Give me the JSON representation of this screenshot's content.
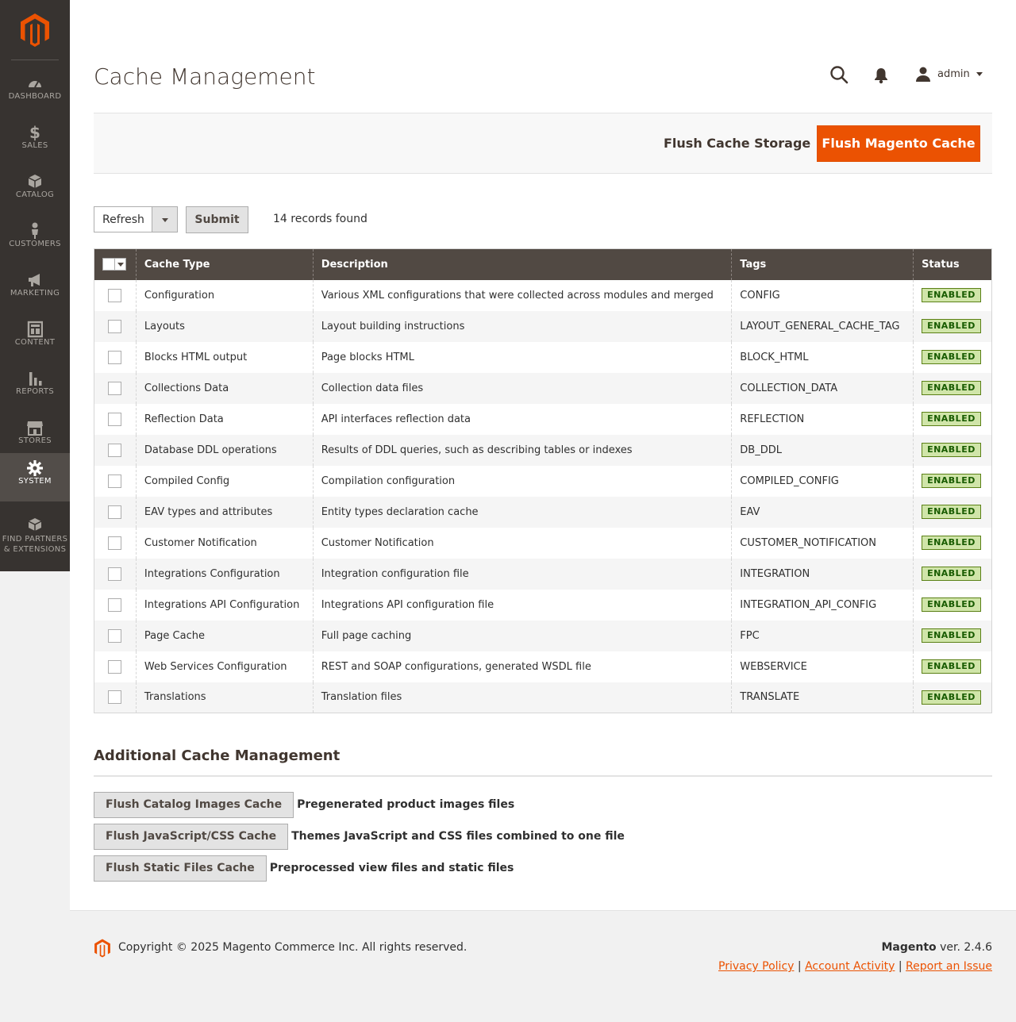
{
  "sidebar": {
    "items": [
      {
        "label": "DASHBOARD",
        "icon": "dashboard-icon"
      },
      {
        "label": "SALES",
        "icon": "dollar-icon"
      },
      {
        "label": "CATALOG",
        "icon": "cube-icon"
      },
      {
        "label": "CUSTOMERS",
        "icon": "person-icon"
      },
      {
        "label": "MARKETING",
        "icon": "megaphone-icon"
      },
      {
        "label": "CONTENT",
        "icon": "layout-icon"
      },
      {
        "label": "REPORTS",
        "icon": "bar-chart-icon"
      },
      {
        "label": "STORES",
        "icon": "storefront-icon"
      },
      {
        "label": "SYSTEM",
        "icon": "gear-icon",
        "active": true
      },
      {
        "label": "FIND PARTNERS",
        "label2": "& EXTENSIONS",
        "icon": "boxes-icon"
      }
    ]
  },
  "header": {
    "title": "Cache Management",
    "user": "admin"
  },
  "actions": {
    "flush_storage": "Flush Cache Storage",
    "flush_magento": "Flush Magento Cache"
  },
  "toolbar": {
    "mass_action": "Refresh",
    "submit": "Submit",
    "records": "14 records found"
  },
  "grid": {
    "columns": [
      "Cache Type",
      "Description",
      "Tags",
      "Status"
    ],
    "rows": [
      {
        "type": "Configuration",
        "desc": "Various XML configurations that were collected across modules and merged",
        "tags": "CONFIG",
        "status": "ENABLED"
      },
      {
        "type": "Layouts",
        "desc": "Layout building instructions",
        "tags": "LAYOUT_GENERAL_CACHE_TAG",
        "status": "ENABLED"
      },
      {
        "type": "Blocks HTML output",
        "desc": "Page blocks HTML",
        "tags": "BLOCK_HTML",
        "status": "ENABLED"
      },
      {
        "type": "Collections Data",
        "desc": "Collection data files",
        "tags": "COLLECTION_DATA",
        "status": "ENABLED"
      },
      {
        "type": "Reflection Data",
        "desc": "API interfaces reflection data",
        "tags": "REFLECTION",
        "status": "ENABLED"
      },
      {
        "type": "Database DDL operations",
        "desc": "Results of DDL queries, such as describing tables or indexes",
        "tags": "DB_DDL",
        "status": "ENABLED"
      },
      {
        "type": "Compiled Config",
        "desc": "Compilation configuration",
        "tags": "COMPILED_CONFIG",
        "status": "ENABLED"
      },
      {
        "type": "EAV types and attributes",
        "desc": "Entity types declaration cache",
        "tags": "EAV",
        "status": "ENABLED"
      },
      {
        "type": "Customer Notification",
        "desc": "Customer Notification",
        "tags": "CUSTOMER_NOTIFICATION",
        "status": "ENABLED"
      },
      {
        "type": "Integrations Configuration",
        "desc": "Integration configuration file",
        "tags": "INTEGRATION",
        "status": "ENABLED"
      },
      {
        "type": "Integrations API Configuration",
        "desc": "Integrations API configuration file",
        "tags": "INTEGRATION_API_CONFIG",
        "status": "ENABLED"
      },
      {
        "type": "Page Cache",
        "desc": "Full page caching",
        "tags": "FPC",
        "status": "ENABLED"
      },
      {
        "type": "Web Services Configuration",
        "desc": "REST and SOAP configurations, generated WSDL file",
        "tags": "WEBSERVICE",
        "status": "ENABLED"
      },
      {
        "type": "Translations",
        "desc": "Translation files",
        "tags": "TRANSLATE",
        "status": "ENABLED"
      }
    ]
  },
  "additional": {
    "title": "Additional Cache Management",
    "items": [
      {
        "button": "Flush Catalog Images Cache",
        "desc": "Pregenerated product images files"
      },
      {
        "button": "Flush JavaScript/CSS Cache",
        "desc": "Themes JavaScript and CSS files combined to one file"
      },
      {
        "button": "Flush Static Files Cache",
        "desc": "Preprocessed view files and static files"
      }
    ]
  },
  "footer": {
    "copyright": "Copyright © 2025 Magento Commerce Inc. All rights reserved.",
    "brand": "Magento",
    "version": " ver. 2.4.6",
    "links": [
      "Privacy Policy",
      "Account Activity",
      "Report an Issue"
    ]
  },
  "colors": {
    "accent": "#eb5202",
    "sidebar": "#373330",
    "header_row": "#514943",
    "enabled_bg": "#d0e5a9",
    "enabled_text": "#185b00"
  }
}
